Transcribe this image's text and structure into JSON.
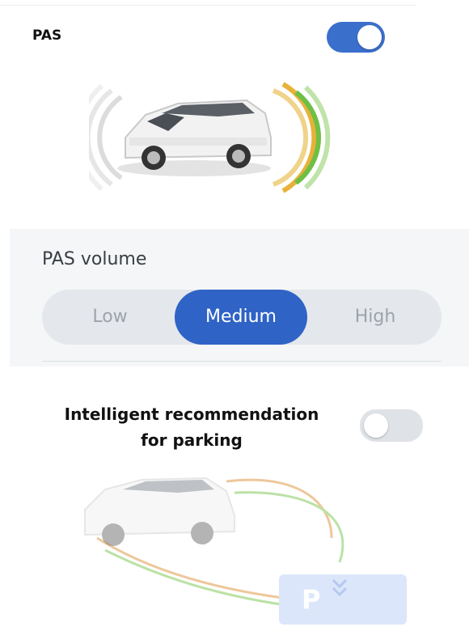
{
  "pas": {
    "title": "PAS",
    "toggle_on": true,
    "toggle_color": "#3b6fcc",
    "sensor_colors": {
      "near": "#e8b23a",
      "far": "#6fbf45",
      "idle": "#d9d9d9"
    }
  },
  "volume": {
    "title": "PAS volume",
    "options": [
      "Low",
      "Medium",
      "High"
    ],
    "selected": "Medium",
    "selected_color": "#2f63c6"
  },
  "parking": {
    "title_line1": "Intelligent recommendation",
    "title_line2": "for parking",
    "toggle_on": false,
    "sign_text": "P",
    "trail_colors": [
      "#e2a25a",
      "#8fcf6a"
    ]
  }
}
